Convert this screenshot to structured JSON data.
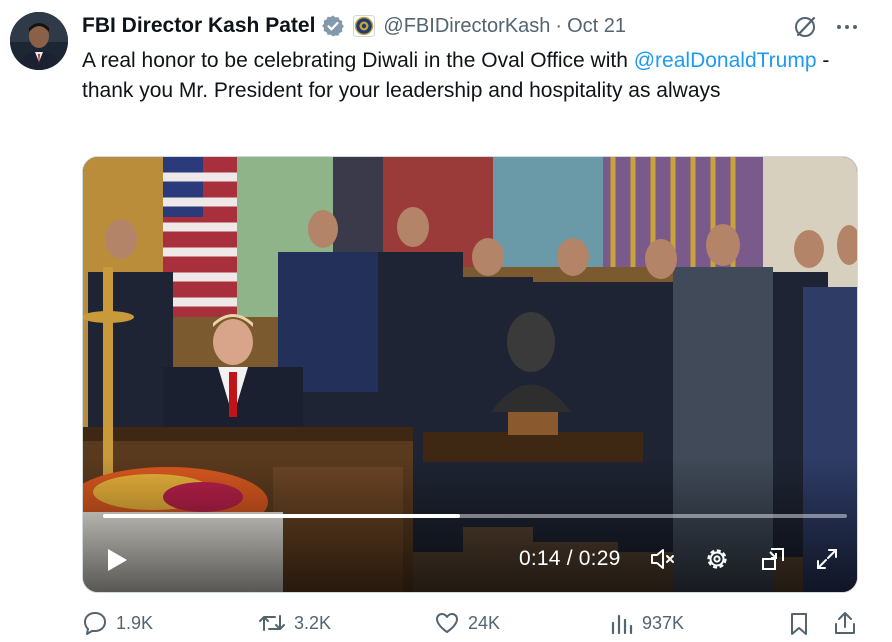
{
  "tweet": {
    "author_name": "FBI Director Kash Patel",
    "handle": "@FBIDirectorKash",
    "separator": "·",
    "timestamp": "Oct 21",
    "text_before": "A real honor to be celebrating Diwali in the Oval Office with ",
    "mention": "@realDonaldTrump",
    "text_after": " - thank you Mr. President for your leadership and hospitality as always"
  },
  "video": {
    "timecode": "0:14 / 0:29",
    "progress": 0.48
  },
  "actions": {
    "replies": "1.9K",
    "reposts": "3.2K",
    "likes": "24K",
    "views": "937K"
  },
  "colors": {
    "text": "#0f1419",
    "secondary": "#536471",
    "link": "#1d9bf0",
    "verified_badge": "#829aab"
  },
  "icons": [
    "verified-badge-icon",
    "fbi-seal-icon",
    "grok-icon",
    "more-icon",
    "play-icon",
    "mute-icon",
    "settings-icon",
    "pip-icon",
    "fullscreen-icon",
    "reply-icon",
    "repost-icon",
    "like-icon",
    "views-icon",
    "bookmark-icon",
    "share-icon"
  ]
}
